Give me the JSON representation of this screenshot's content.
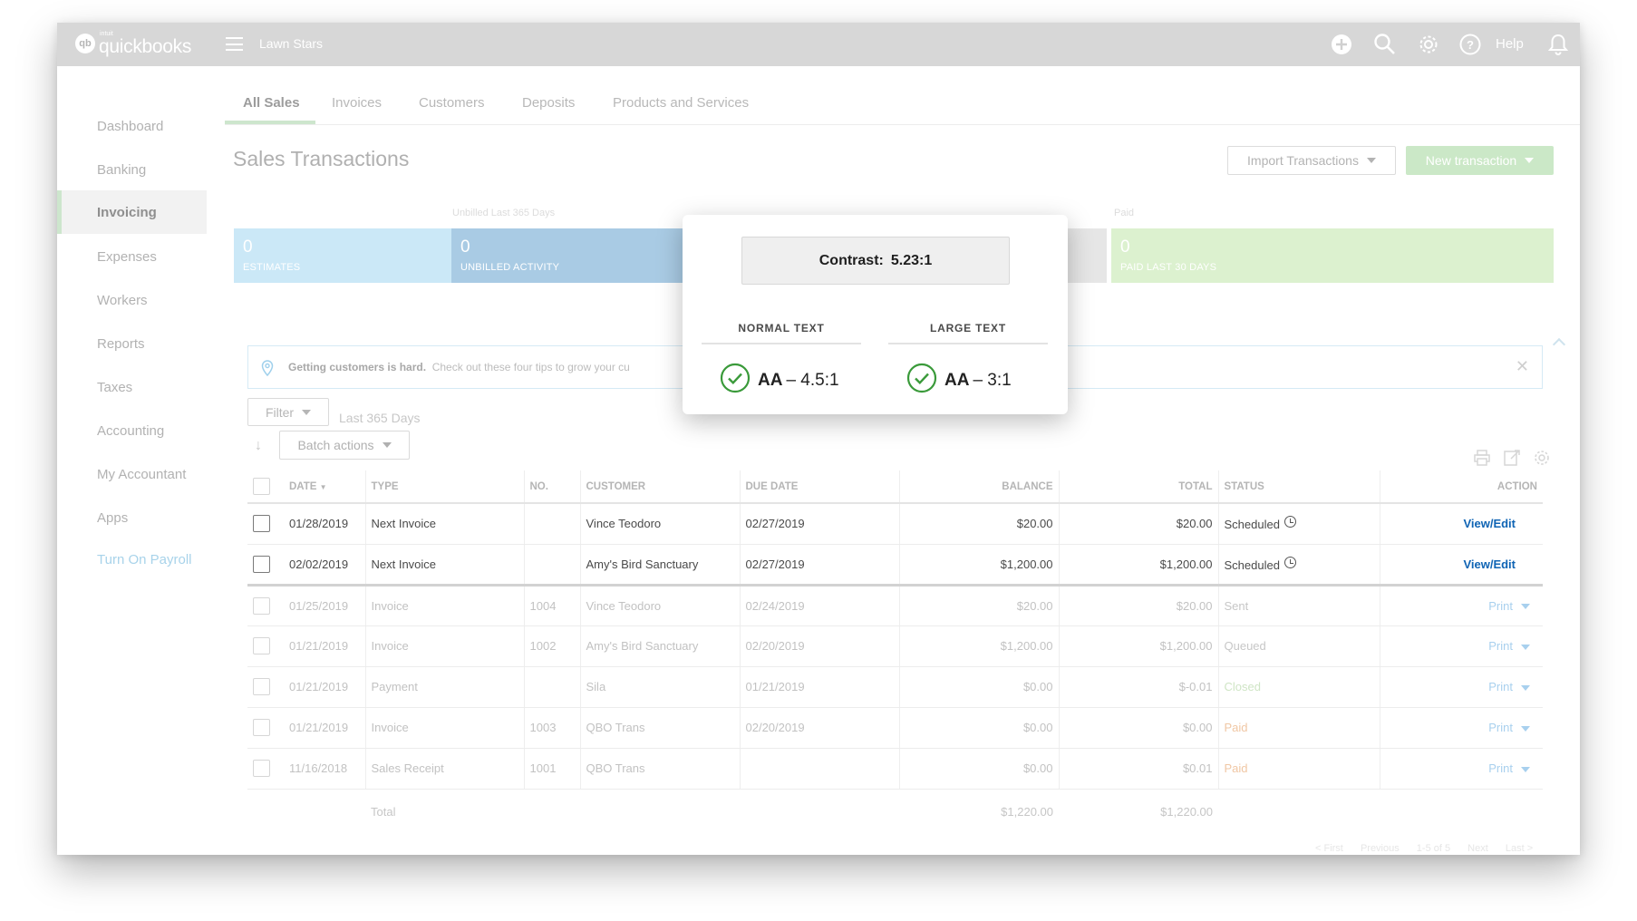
{
  "app": {
    "logo_small": "intuit",
    "logo_name": "quickbooks",
    "company": "Lawn Stars",
    "help": "Help"
  },
  "sidebar": {
    "items": [
      {
        "label": "Dashboard"
      },
      {
        "label": "Banking"
      },
      {
        "label": "Invoicing"
      },
      {
        "label": "Expenses"
      },
      {
        "label": "Workers"
      },
      {
        "label": "Reports"
      },
      {
        "label": "Taxes"
      },
      {
        "label": "Accounting"
      },
      {
        "label": "My Accountant"
      },
      {
        "label": "Apps"
      },
      {
        "label": "Turn On Payroll"
      }
    ]
  },
  "tabs": [
    {
      "label": "All Sales"
    },
    {
      "label": "Invoices"
    },
    {
      "label": "Customers"
    },
    {
      "label": "Deposits"
    },
    {
      "label": "Products and Services"
    }
  ],
  "page": {
    "title": "Sales Transactions",
    "import_button": "Import Transactions",
    "new_button": "New transaction"
  },
  "money_bar": {
    "unbilled_label": "Unbilled Last 365 Days",
    "paid_label": "Paid",
    "estimates": {
      "value": "0",
      "label": "ESTIMATES"
    },
    "unbilled": {
      "value": "0",
      "label": "UNBILLED ACTIVITY"
    },
    "paid": {
      "value": "0",
      "label": "PAID LAST 30 DAYS"
    }
  },
  "banner": {
    "bold": "Getting customers is hard.",
    "text": "Check out these four tips to grow your cu"
  },
  "filter": {
    "button": "Filter",
    "range": "Last 365 Days",
    "batch": "Batch actions"
  },
  "table": {
    "headers": {
      "date": "DATE",
      "type": "TYPE",
      "no": "NO.",
      "customer": "CUSTOMER",
      "due": "DUE DATE",
      "balance": "BALANCE",
      "total": "TOTAL",
      "status": "STATUS",
      "action": "ACTION"
    },
    "rows": [
      {
        "date": "01/28/2019",
        "type": "Next Invoice",
        "no": "",
        "customer": "Vince Teodoro",
        "due": "02/27/2019",
        "balance": "$20.00",
        "total": "$20.00",
        "status": "Scheduled",
        "action": "View/Edit"
      },
      {
        "date": "02/02/2019",
        "type": "Next Invoice",
        "no": "",
        "customer": "Amy's Bird Sanctuary",
        "due": "02/27/2019",
        "balance": "$1,200.00",
        "total": "$1,200.00",
        "status": "Scheduled",
        "action": "View/Edit"
      },
      {
        "date": "01/25/2019",
        "type": "Invoice",
        "no": "1004",
        "customer": "Vince Teodoro",
        "due": "02/24/2019",
        "balance": "$20.00",
        "total": "$20.00",
        "status": "Sent",
        "action": "Print"
      },
      {
        "date": "01/21/2019",
        "type": "Invoice",
        "no": "1002",
        "customer": "Amy's Bird Sanctuary",
        "due": "02/20/2019",
        "balance": "$1,200.00",
        "total": "$1,200.00",
        "status": "Queued",
        "action": "Print"
      },
      {
        "date": "01/21/2019",
        "type": "Payment",
        "no": "",
        "customer": "Sila",
        "due": "01/21/2019",
        "balance": "$0.00",
        "total": "$-0.01",
        "status": "Closed",
        "action": "Print"
      },
      {
        "date": "01/21/2019",
        "type": "Invoice",
        "no": "1003",
        "customer": "QBO Trans",
        "due": "02/20/2019",
        "balance": "$0.00",
        "total": "$0.00",
        "status": "Paid",
        "action": "Print"
      },
      {
        "date": "11/16/2018",
        "type": "Sales Receipt",
        "no": "1001",
        "customer": "QBO Trans",
        "due": "",
        "balance": "$0.00",
        "total": "$0.01",
        "status": "Paid",
        "action": "Print"
      }
    ],
    "total": {
      "label": "Total",
      "balance": "$1,220.00",
      "total": "$1,220.00"
    }
  },
  "pager": {
    "first": "< First",
    "previous": "Previous",
    "range": "1-5 of 5",
    "next": "Next",
    "last": "Last >"
  },
  "contrast_popover": {
    "contrast_label": "Contrast:",
    "contrast_value": "5.23:1",
    "normal_heading": "NORMAL TEXT",
    "large_heading": "LARGE TEXT",
    "normal_level": "AA",
    "normal_ratio": "– 4.5:1",
    "large_level": "AA",
    "large_ratio": "– 3:1",
    "pass_color": "#3a9a3a"
  }
}
